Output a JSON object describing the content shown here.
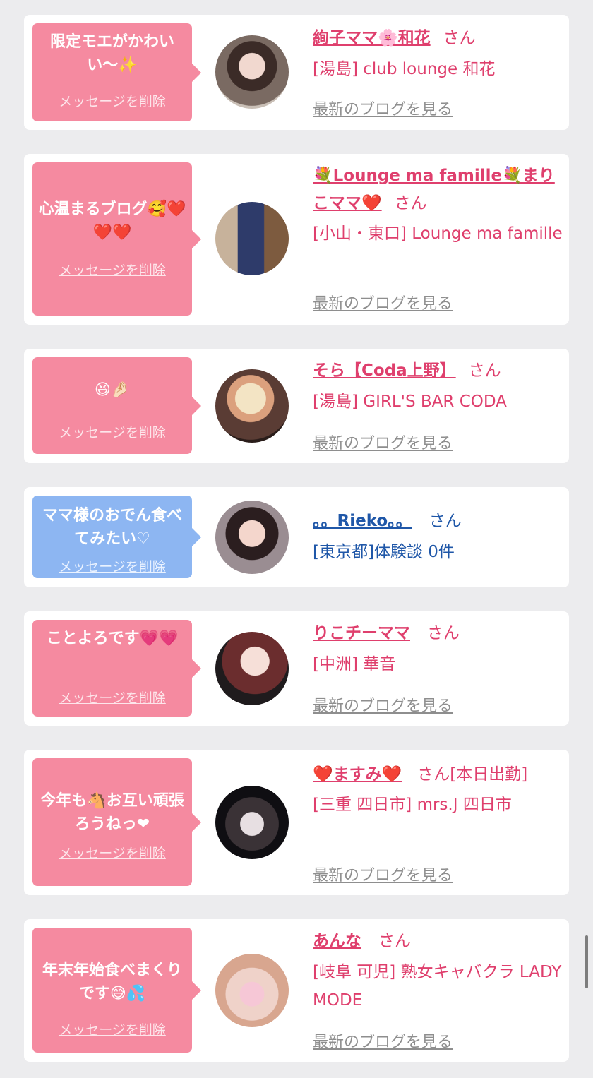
{
  "common": {
    "delete_label": "メッセージを削除",
    "blog_label": "最新のブログを見る",
    "san_label": "さん"
  },
  "colors": {
    "pink_bubble": "#f58aa0",
    "blue_bubble": "#8db6f2",
    "pink_text": "#df3f6d",
    "blue_text": "#1f57a8",
    "link_gray": "#8e8e8e"
  },
  "cards": [
    {
      "message": "限定モエがかわいい〜✨",
      "name": "絢子ママ🌸和花",
      "name_suffix": "",
      "shop": "[湯島] club lounge 和花",
      "theme": "pink"
    },
    {
      "message": "心温まるブログ🥰❤️❤️❤️",
      "name": "💐Lounge ma famille💐まりこママ❤️",
      "name_suffix": "",
      "shop": "[小山・東口] Lounge ma famille",
      "theme": "pink"
    },
    {
      "message": "😆🤌🏻",
      "name": "そら【Coda上野】",
      "name_suffix": "",
      "shop": "[湯島] GIRL'S BAR CODA",
      "theme": "pink"
    },
    {
      "message": "ママ様のおでん食べてみたい♡",
      "name": "。。Rieko。。",
      "name_suffix": "",
      "shop": "[東京都]体験談 0件",
      "theme": "blue"
    },
    {
      "message": "ことよろです💗💗",
      "name": "りこチーママ",
      "name_suffix": "",
      "shop": "[中洲] 華音",
      "theme": "pink"
    },
    {
      "message": "今年も🐴お互い頑張ろうねっ❤︎",
      "name": "❤️ますみ❤️",
      "name_suffix": "[本日出勤]",
      "shop": "[三重 四日市] mrs.J 四日市",
      "theme": "pink"
    },
    {
      "message": "年末年始食べまくりです😅💦",
      "name": "あんな",
      "name_suffix": "",
      "shop": "[岐阜 可児] 熟女キャバクラ LADY MODE",
      "theme": "pink"
    }
  ]
}
